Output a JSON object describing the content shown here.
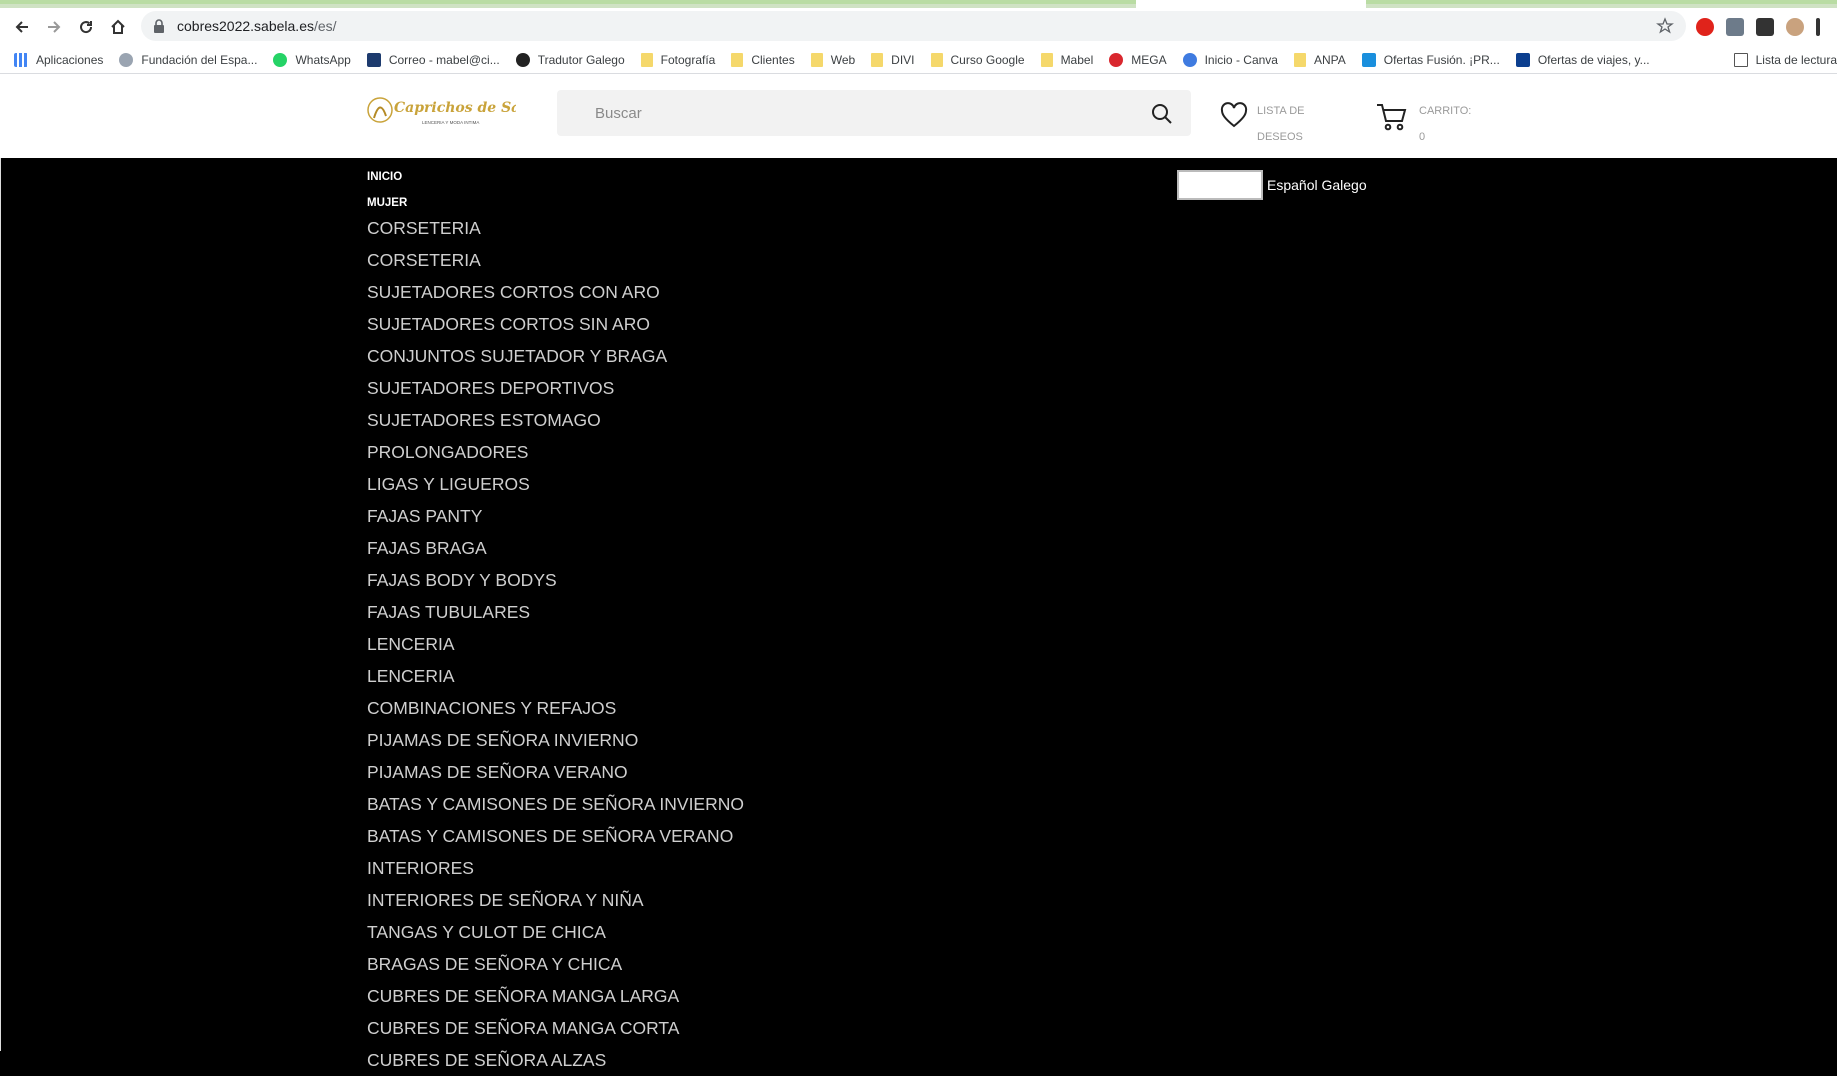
{
  "browser": {
    "url_host": "cobres2022.sabela.es",
    "url_path": "/es/",
    "bookmarks": [
      {
        "label": "Aplicaciones",
        "icon": "apps-grid-icon"
      },
      {
        "label": "Fundación del Espa...",
        "icon": "site-favicon-icon"
      },
      {
        "label": "WhatsApp",
        "icon": "whatsapp-icon"
      },
      {
        "label": "Correo - mabel@ci...",
        "icon": "mail-icon"
      },
      {
        "label": "Tradutor Galego",
        "icon": "translate-icon"
      },
      {
        "label": "Fotografía",
        "icon": "folder-icon"
      },
      {
        "label": "Clientes",
        "icon": "folder-icon"
      },
      {
        "label": "Web",
        "icon": "folder-icon"
      },
      {
        "label": "DIVI",
        "icon": "folder-icon"
      },
      {
        "label": "Curso Google",
        "icon": "folder-icon"
      },
      {
        "label": "Mabel",
        "icon": "folder-icon"
      },
      {
        "label": "MEGA",
        "icon": "mega-icon"
      },
      {
        "label": "Inicio - Canva",
        "icon": "canva-icon"
      },
      {
        "label": "ANPA",
        "icon": "folder-icon"
      },
      {
        "label": "Ofertas Fusión. ¡PR...",
        "icon": "movistar-icon"
      },
      {
        "label": "Ofertas de viajes, y...",
        "icon": "travel-icon"
      }
    ],
    "reading_list": "Lista de lectura"
  },
  "header": {
    "logo_text": "Caprichos de Sabela",
    "logo_subtitle": "LENCERIA Y MODA INTIMA",
    "search_placeholder": "Buscar",
    "wishlist_line1": "LISTA DE",
    "wishlist_line2": "DESEOS",
    "cart_line1": "CARRITO:",
    "cart_count": "0"
  },
  "menu": {
    "top_items": [
      "INICIO",
      "MUJER"
    ],
    "categories": [
      "CORSETERIA",
      "CORSETERIA",
      "SUJETADORES CORTOS CON ARO",
      "SUJETADORES CORTOS SIN ARO",
      "CONJUNTOS SUJETADOR Y BRAGA",
      "SUJETADORES DEPORTIVOS",
      "SUJETADORES ESTOMAGO",
      "PROLONGADORES",
      "LIGAS Y LIGUEROS",
      "FAJAS PANTY",
      "FAJAS BRAGA",
      "FAJAS BODY Y BODYS",
      "FAJAS TUBULARES",
      "LENCERIA",
      "LENCERIA",
      "COMBINACIONES Y REFAJOS",
      "PIJAMAS DE SEÑORA INVIERNO",
      "PIJAMAS DE SEÑORA VERANO",
      "BATAS Y CAMISONES DE SEÑORA INVIERNO",
      "BATAS Y CAMISONES DE SEÑORA VERANO",
      "INTERIORES",
      "INTERIORES DE SEÑORA Y NIÑA",
      "TANGAS Y CULOT DE CHICA",
      "BRAGAS DE SEÑORA Y CHICA",
      "CUBRES DE SEÑORA MANGA LARGA",
      "CUBRES DE SEÑORA MANGA CORTA",
      "CUBRES DE SEÑORA ALZAS"
    ]
  },
  "language": {
    "selected": "Español",
    "options_text": "Español Galego"
  }
}
